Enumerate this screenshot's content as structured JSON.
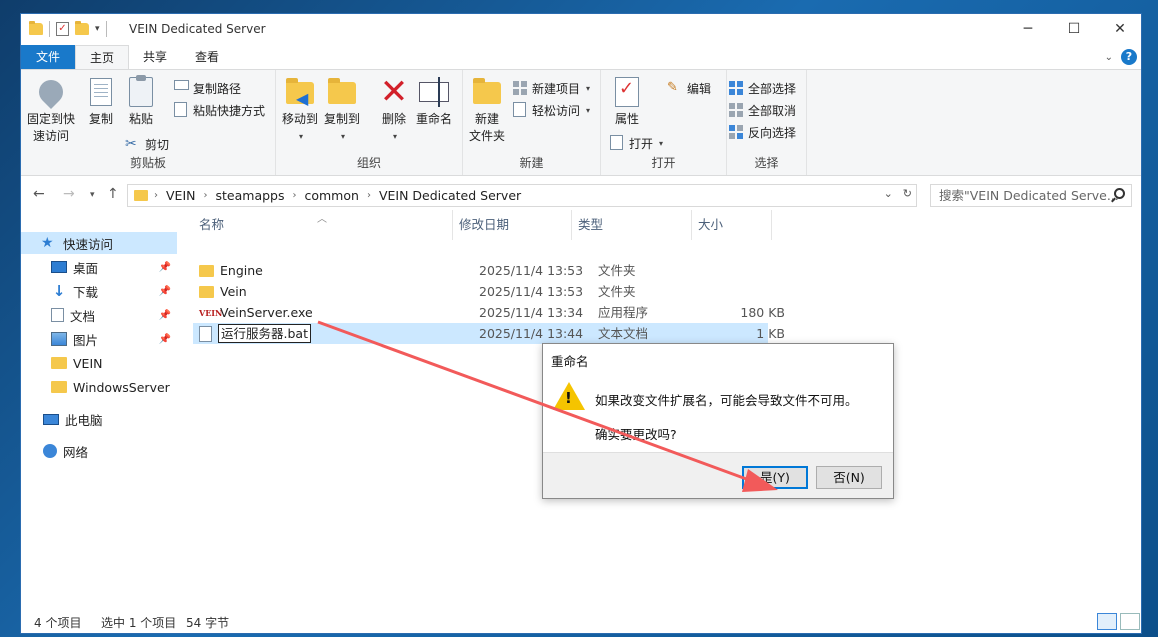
{
  "window": {
    "title": "VEIN Dedicated Server"
  },
  "ribbon_tabs": [
    "文件",
    "主页",
    "共享",
    "查看"
  ],
  "ribbon": {
    "clipboard": {
      "pin": "固定到快",
      "pin2": "速访问",
      "copy": "复制",
      "paste": "粘贴",
      "copy_path": "复制路径",
      "paste_shortcut": "粘贴快捷方式",
      "cut": "剪切",
      "label": "剪贴板"
    },
    "organize": {
      "move_to": "移动到",
      "copy_to": "复制到",
      "delete": "删除",
      "rename": "重命名",
      "label": "组织"
    },
    "new": {
      "new_folder": "新建",
      "new_folder2": "文件夹",
      "new_item": "新建项目",
      "easy_access": "轻松访问",
      "label": "新建"
    },
    "open": {
      "properties": "属性",
      "open": "打开",
      "edit": "编辑",
      "label": "打开"
    },
    "select": {
      "select_all": "全部选择",
      "select_none": "全部取消",
      "invert": "反向选择",
      "label": "选择"
    }
  },
  "address": {
    "crumbs": [
      "VEIN",
      "steamapps",
      "common",
      "VEIN Dedicated Server"
    ]
  },
  "search": {
    "placeholder": "搜索\"VEIN Dedicated Serve..."
  },
  "nav": {
    "quick_access": "快速访问",
    "desktop": "桌面",
    "downloads": "下载",
    "documents": "文档",
    "pictures": "图片",
    "vein": "VEIN",
    "windowsserver": "WindowsServer",
    "this_pc": "此电脑",
    "network": "网络"
  },
  "columns": {
    "name": "名称",
    "date": "修改日期",
    "type": "类型",
    "size": "大小"
  },
  "files": [
    {
      "name": "Engine",
      "date": "2025/11/4 13:53",
      "type": "文件夹",
      "size": ""
    },
    {
      "name": "Vein",
      "date": "2025/11/4 13:53",
      "type": "文件夹",
      "size": ""
    },
    {
      "name": "VeinServer.exe",
      "date": "2025/11/4 13:34",
      "type": "应用程序",
      "size": "180 KB"
    },
    {
      "name": "运行服务器.bat",
      "date": "2025/11/4 13:44",
      "type": "文本文档",
      "size": "1 KB"
    }
  ],
  "status": {
    "count": "4 个项目",
    "selected": "选中 1 个项目",
    "bytes": "54 字节"
  },
  "dialog": {
    "title": "重命名",
    "message": "如果改变文件扩展名，可能会导致文件不可用。",
    "question": "确实要更改吗?",
    "yes": "是(Y)",
    "no": "否(N)"
  },
  "colors": {
    "accent": "#1979ca",
    "selection": "#cce8ff",
    "annotation_arrow": "#f25a5a"
  }
}
